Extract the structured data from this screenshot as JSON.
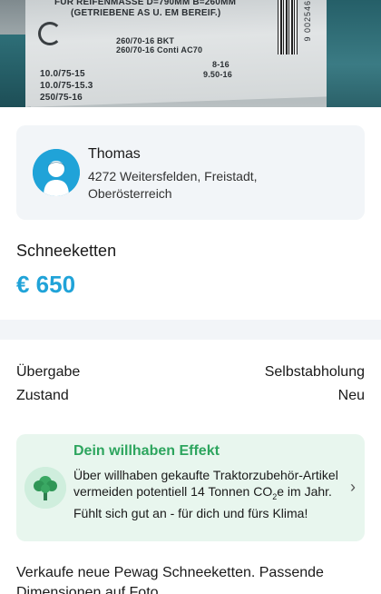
{
  "photo": {
    "lines": [
      "FÜR REIFENMASSE D=790MM B=260MM",
      "(GETRIEBENE AS U. EM BEREIF.)",
      "260/70-16 BKT",
      "260/70-16 Conti AC70",
      "8-16",
      "9.50-16",
      "10.0/75-15",
      "10.0/75-15.3",
      "250/75-16"
    ],
    "barcode_number": "9 002546",
    "alt": "Product photo of packaging label"
  },
  "seller": {
    "name": "Thomas",
    "location": "4272 Weitersfelden, Freistadt, Oberösterreich"
  },
  "listing": {
    "title": "Schneeketten",
    "price": "€ 650"
  },
  "attributes": [
    {
      "label": "Übergabe",
      "value": "Selbstabholung"
    },
    {
      "label": "Zustand",
      "value": "Neu"
    }
  ],
  "effect": {
    "title": "Dein willhaben Effekt",
    "text_before": "Über willhaben gekaufte Traktorzubehör-Artikel vermeiden potentiell 14 Tonnen CO",
    "subscript": "2",
    "text_after": "e im Jahr. Fühlt sich gut an - für dich und fürs Klima!",
    "chevron": "›"
  },
  "description": "Verkaufe neue Pewag Schneeketten. Passende Dimensionen auf Foto",
  "colors": {
    "accent": "#20a3d8",
    "effect_green": "#2da55e",
    "effect_bg": "#e8f6ee",
    "card_bg": "#f2f5f8"
  }
}
